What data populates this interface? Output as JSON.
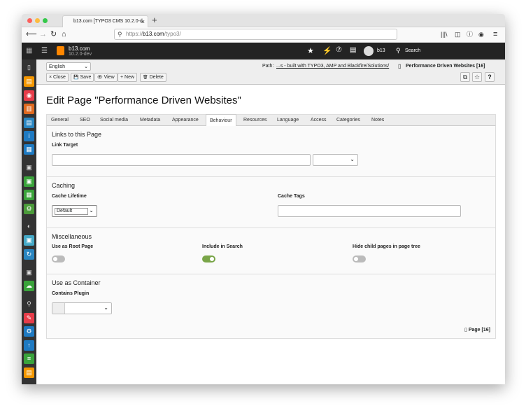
{
  "browser": {
    "tab_title": "b13.com [TYPO3 CMS 10.2.0-d",
    "url_prefix": "https://",
    "url_host": "b13.com",
    "url_path": "/typo3/",
    "new_tab": "+"
  },
  "typo3": {
    "site_name": "b13.com",
    "version": "10.2.0-dev",
    "user": "b13",
    "search_label": "Search"
  },
  "docheader": {
    "language": "English",
    "path_label": "Path:",
    "path": "...s - built with TYPO3, AMP and Blackfire/Solutions/",
    "page_title": "Performance Driven Websites [16]",
    "buttons": [
      {
        "icon": "×",
        "label": "Close"
      },
      {
        "icon": "💾",
        "label": "Save"
      },
      {
        "icon": "👁",
        "label": "View"
      },
      {
        "icon": "+",
        "label": "New"
      },
      {
        "icon": "🗑",
        "label": "Delete"
      }
    ]
  },
  "page": {
    "heading": "Edit Page \"Performance Driven Websites\""
  },
  "tabs": [
    "General",
    "SEO",
    "Social media",
    "Metadata",
    "Appearance",
    "Behaviour",
    "Resources",
    "Language",
    "Access",
    "Categories",
    "Notes"
  ],
  "active_tab": "Behaviour",
  "sections": {
    "links": {
      "title": "Links to this Page",
      "link_target_label": "Link Target"
    },
    "caching": {
      "title": "Caching",
      "lifetime_label": "Cache Lifetime",
      "lifetime_value": "Default",
      "tags_label": "Cache Tags"
    },
    "misc": {
      "title": "Miscellaneous",
      "root_label": "Use as Root Page",
      "root_on": false,
      "search_label": "Include in Search",
      "search_on": true,
      "hide_label": "Hide child pages in page tree",
      "hide_on": false
    },
    "container": {
      "title": "Use as Container",
      "plugin_label": "Contains Plugin"
    }
  },
  "footer": {
    "label": "Page [16]"
  },
  "colors": {
    "toggle_on": "#79a548",
    "toggle_off": "#bbbbbb",
    "typo3_orange": "#ff8700",
    "header_bg": "#232323"
  }
}
